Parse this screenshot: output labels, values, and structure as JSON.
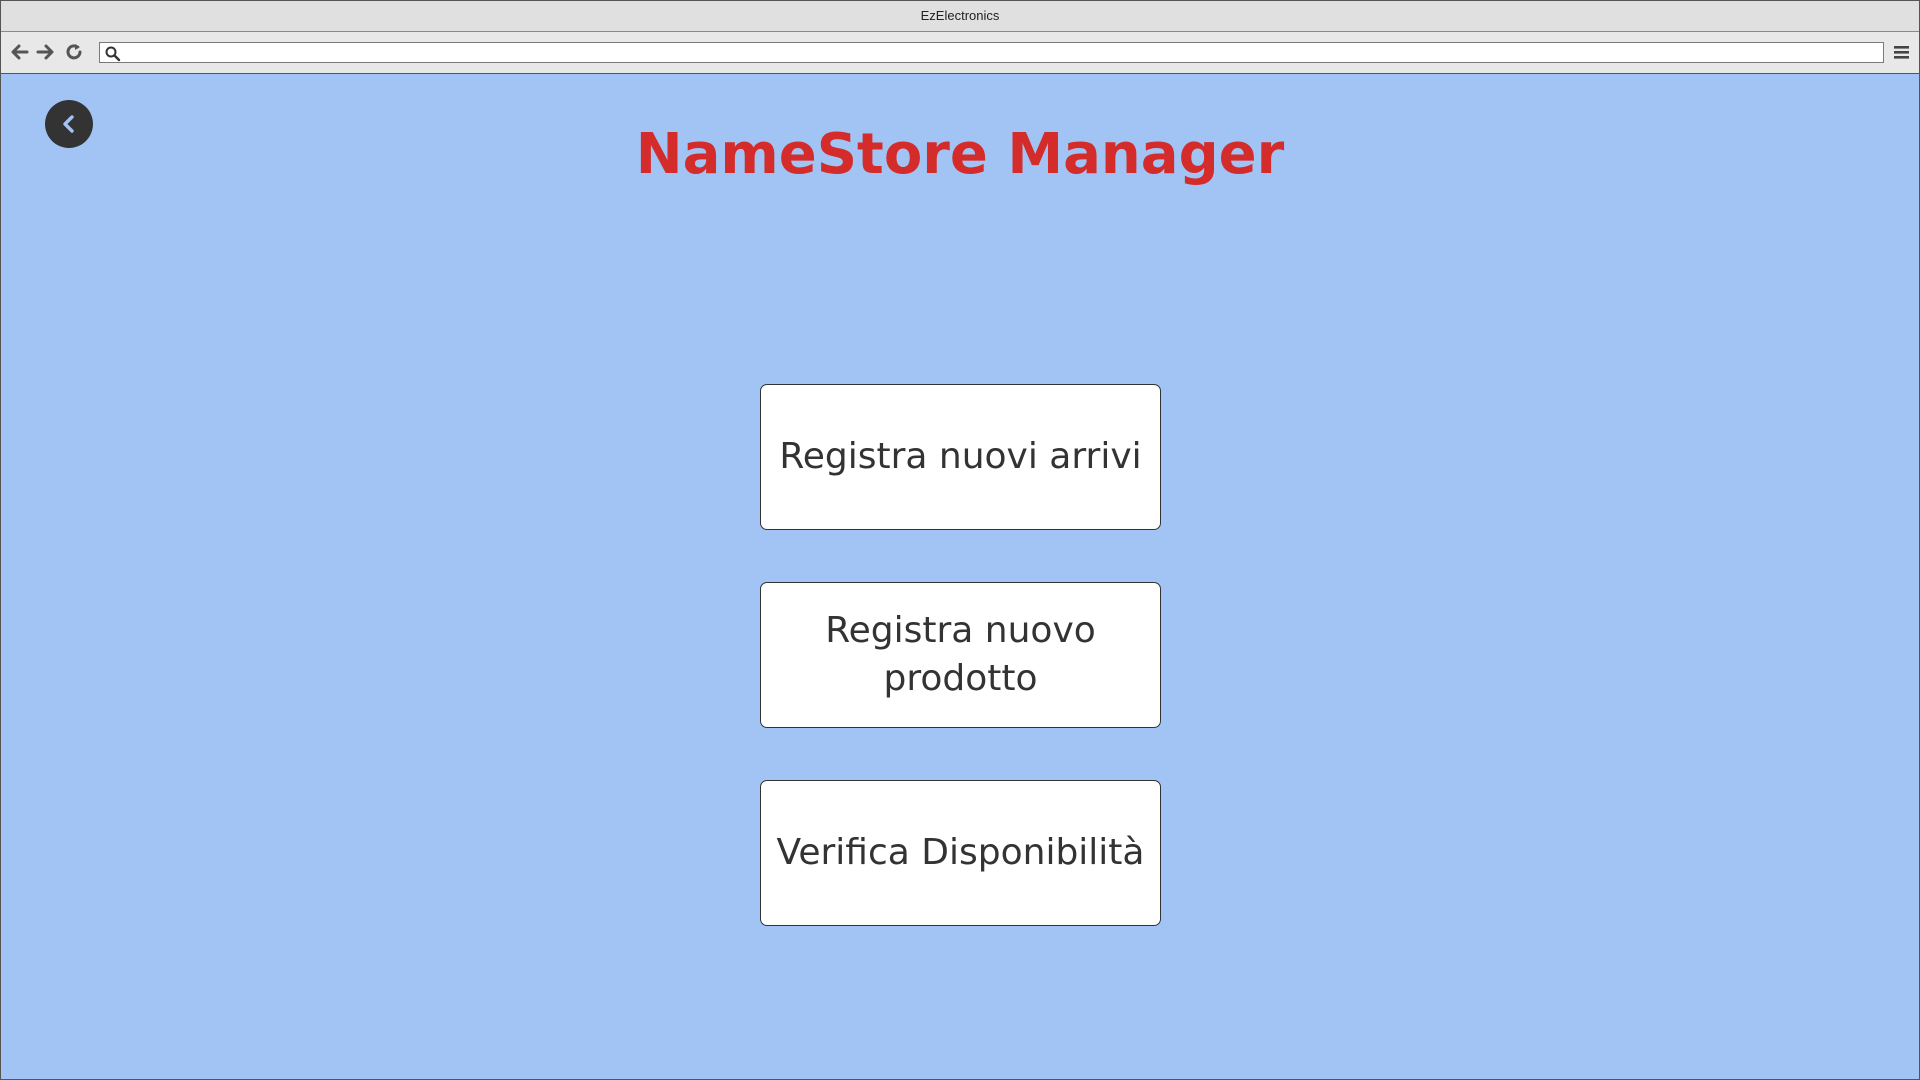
{
  "window": {
    "title": "EzElectronics"
  },
  "toolbar": {
    "address_value": "",
    "icons": [
      "back-arrow-icon",
      "forward-arrow-icon",
      "reload-icon",
      "search-icon",
      "hamburger-menu-icon"
    ]
  },
  "page": {
    "back_icon": "chevron-left-icon",
    "title": "NameStore Manager",
    "title_color": "#d42b2b",
    "background_color": "#a1c4f5"
  },
  "menu": {
    "items": [
      {
        "label": "Registra nuovi arrivi"
      },
      {
        "label": "Registra nuovo prodotto"
      },
      {
        "label": "Verifica Disponibilità"
      }
    ]
  }
}
